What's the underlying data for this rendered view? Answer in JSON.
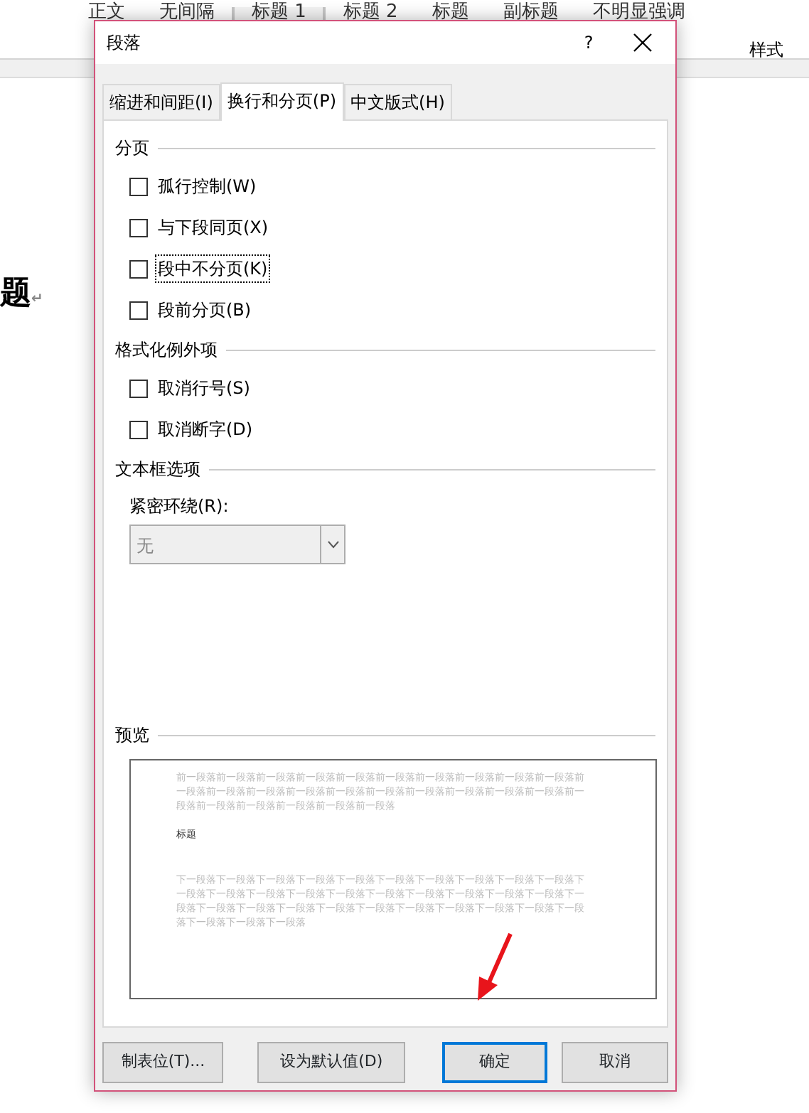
{
  "ribbon": {
    "styles": [
      {
        "label": "正文",
        "selected": false
      },
      {
        "label": "无间隔",
        "selected": false
      },
      {
        "label": "标题 1",
        "selected": true
      },
      {
        "label": "标题 2",
        "selected": false
      },
      {
        "label": "标题",
        "selected": false
      },
      {
        "label": "副标题",
        "selected": false
      },
      {
        "label": "不明显强调",
        "selected": false
      }
    ],
    "group_label": "样式"
  },
  "document": {
    "heading": "题",
    "mark": "↵"
  },
  "dialog": {
    "title": "段落",
    "help": "?",
    "tabs": [
      {
        "label": "缩进和间距(I)",
        "selected": false
      },
      {
        "label": "换行和分页(P)",
        "selected": true
      },
      {
        "label": "中文版式(H)",
        "selected": false
      }
    ],
    "sections": [
      {
        "title": "分页",
        "options": [
          {
            "label": "孤行控制(W)",
            "checked": false,
            "focused": false
          },
          {
            "label": "与下段同页(X)",
            "checked": false,
            "focused": false
          },
          {
            "label": "段中不分页(K)",
            "checked": false,
            "focused": true
          },
          {
            "label": "段前分页(B)",
            "checked": false,
            "focused": false
          }
        ]
      },
      {
        "title": "格式化例外项",
        "options": [
          {
            "label": "取消行号(S)",
            "checked": false,
            "focused": false
          },
          {
            "label": "取消断字(D)",
            "checked": false,
            "focused": false
          }
        ]
      },
      {
        "title": "文本框选项",
        "field": {
          "label": "紧密环绕(R):",
          "value": "无",
          "disabled": true
        }
      }
    ],
    "preview": {
      "title": "预览",
      "before": [
        "前一段落前一段落前一段落前一段落前一段落前一段落前一段落前一段落前一段落前一段落前",
        "一段落前一段落前一段落前一段落前一段落前一段落前一段落前一段落前一段落前一段落前一",
        "段落前一段落前一段落前一段落前一段落前一段落"
      ],
      "heading": "标题",
      "after": [
        "下一段落下一段落下一段落下一段落下一段落下一段落下一段落下一段落下一段落下一段落下",
        "一段落下一段落下一段落下一段落下一段落下一段落下一段落下一段落下一段落下一段落下一",
        "段落下一段落下一段落下一段落下一段落下一段落下一段落下一段落下一段落下一段落下一段",
        "落下一段落下一段落下一段落"
      ]
    },
    "buttons": [
      {
        "label": "制表位(T)...",
        "default": false
      },
      {
        "label": "设为默认值(D)",
        "default": false
      },
      {
        "label": "确定",
        "default": true
      },
      {
        "label": "取消",
        "default": false
      }
    ]
  }
}
